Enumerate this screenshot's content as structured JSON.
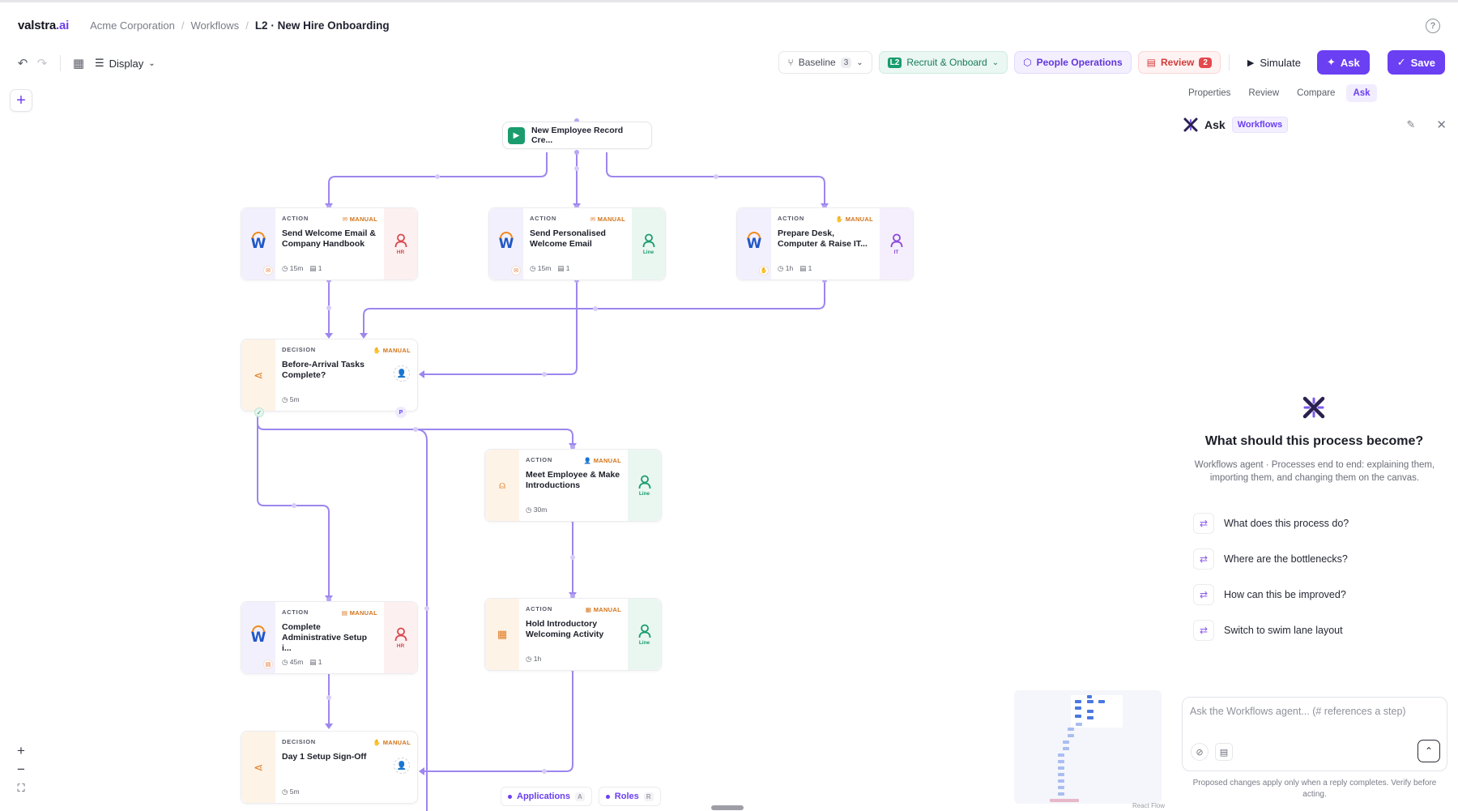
{
  "header": {
    "logo_main": "valstra",
    "logo_suffix": ".ai",
    "breadcrumbs": [
      "Acme Corporation",
      "Workflows"
    ],
    "current": "L2 · New Hire Onboarding",
    "help_icon": "help-circle-icon"
  },
  "toolbar": {
    "display_label": "Display",
    "baseline_label": "Baseline",
    "baseline_count": "3",
    "level_badge": "L2",
    "level_label": "Recruit & Onboard",
    "people_label": "People Operations",
    "review_label": "Review",
    "review_count": "2",
    "simulate_label": "Simulate",
    "ask_label": "Ask",
    "save_label": "Save"
  },
  "canvas": {
    "trigger": "New Employee Record Cre...",
    "nodes": {
      "n1": {
        "kind": "ACTION",
        "mode": "MANUAL",
        "title": "Send Welcome Email & Company Handbook",
        "duration": "15m",
        "count": "1",
        "role": "HR"
      },
      "n2": {
        "kind": "ACTION",
        "mode": "MANUAL",
        "title": "Send Personalised Welcome Email",
        "duration": "15m",
        "count": "1",
        "role": "Line"
      },
      "n3": {
        "kind": "ACTION",
        "mode": "MANUAL",
        "title": "Prepare Desk, Computer & Raise IT...",
        "duration": "1h",
        "count": "1",
        "role": "IT"
      },
      "n4": {
        "kind": "DECISION",
        "mode": "MANUAL",
        "title": "Before-Arrival Tasks Complete?",
        "duration": "5m",
        "badge": "P"
      },
      "n5": {
        "kind": "ACTION",
        "mode": "MANUAL",
        "title": "Meet Employee & Make Introductions",
        "duration": "30m",
        "role": "Line"
      },
      "n6": {
        "kind": "ACTION",
        "mode": "MANUAL",
        "title": "Complete Administrative Setup i...",
        "duration": "45m",
        "count": "1",
        "role": "HR"
      },
      "n7": {
        "kind": "ACTION",
        "mode": "MANUAL",
        "title": "Hold Introductory Welcoming Activity",
        "duration": "1h",
        "role": "Line"
      },
      "n8": {
        "kind": "DECISION",
        "mode": "MANUAL",
        "title": "Day 1 Setup Sign-Off",
        "duration": "5m"
      }
    },
    "legend": [
      {
        "label": "Applications",
        "key": "A"
      },
      {
        "label": "Roles",
        "key": "R"
      }
    ],
    "react_flow": "React Flow",
    "edge_color": "#9d86ee"
  },
  "panel": {
    "tabs": [
      "Properties",
      "Review",
      "Compare",
      "Ask"
    ],
    "active_tab": "Ask",
    "ask_title": "Ask",
    "ask_tag": "Workflows",
    "hero": "What should this process become?",
    "hero_sub": "Workflows agent · Processes end to end: explaining them, importing them, and changing them on the canvas.",
    "suggestions": [
      "What does this process do?",
      "Where are the bottlenecks?",
      "How can this be improved?",
      "Switch to swim lane layout"
    ],
    "input_placeholder": "Ask the Workflows agent... (# references a step)",
    "disclaimer": "Proposed changes apply only when a reply completes. Verify before acting."
  },
  "colors": {
    "accent": "#6b3ff2",
    "success": "#1a9c6e",
    "manual": "#d2741b",
    "danger": "#e5484d"
  }
}
